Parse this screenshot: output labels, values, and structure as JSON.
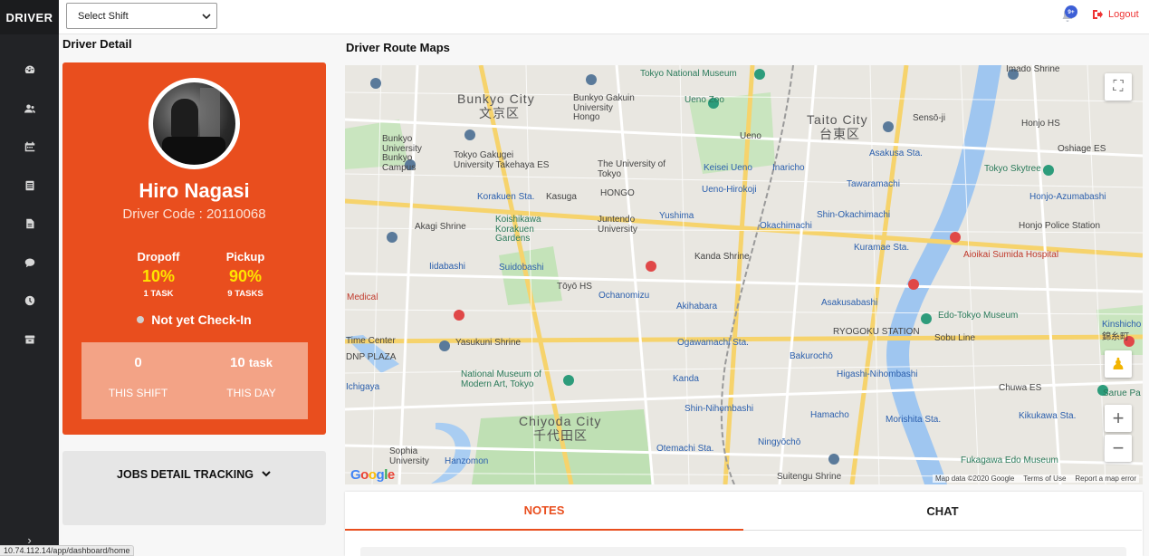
{
  "app": {
    "brand": "DRIVER"
  },
  "sidebar": {
    "items": [
      {
        "icon": "dashboard-icon"
      },
      {
        "icon": "users-icon"
      },
      {
        "icon": "calendar-icon"
      },
      {
        "icon": "list-icon"
      },
      {
        "icon": "file-icon"
      },
      {
        "icon": "chat-icon"
      },
      {
        "icon": "clock-icon"
      },
      {
        "icon": "archive-icon"
      }
    ],
    "expand_glyph": "›"
  },
  "topbar": {
    "shift_select": {
      "value": "Select Shift"
    },
    "notifications": {
      "badge": "9+"
    },
    "logout_label": "Logout"
  },
  "driver_detail": {
    "title": "Driver Detail",
    "name": "Hiro Nagasi",
    "code": "Driver Code : 20110068",
    "dropoff": {
      "label": "Dropoff",
      "value": "10%",
      "tasks": "1 TASK"
    },
    "pickup": {
      "label": "Pickup",
      "value": "90%",
      "tasks": "9 TASKS"
    },
    "checkin_status": "Not yet Check-In",
    "this_shift": {
      "count": "0",
      "label": "THIS SHIFT"
    },
    "this_day": {
      "count": "10",
      "unit": "task",
      "label": "THIS DAY"
    },
    "jobs_tracking": "JOBS DETAIL TRACKING"
  },
  "map": {
    "title": "Driver Route Maps",
    "labels": {
      "bunkyo": "Bunkyo City",
      "bunkyo_jp": "文京区",
      "taito": "Taito City",
      "taito_jp": "台東区",
      "chiyoda": "Chiyoda City",
      "chiyoda_jp": "千代田区",
      "tokyo_museum": "Tokyo National Museum",
      "ueno_zoo": "Ueno Zoo",
      "ueno": "Ueno",
      "senso": "Sensō-ji",
      "imado": "Imado Shrine",
      "asakusa": "Asakusa Sta.",
      "skytree": "Tokyo Skytree",
      "kasuga": "Kasuga",
      "koishikawa": "Koishikawa Korakuen Gardens",
      "juntendo": "Juntendo University",
      "kanda_shrine": "Kanda Shrine",
      "akihabara": "Akihabara",
      "ochanomizu": "Ochanomizu",
      "iidabashi": "Iidabashi",
      "suidobashi": "Suidobashi",
      "yasukuni": "Yasukuni Shrine",
      "national_museum": "National Museum of Modern Art, Tokyo",
      "aioikai": "Aioikai Sumida Hospital",
      "edo_museum": "Edo-Tokyo Museum",
      "ryogoku": "RYOGOKU STATION",
      "sobu": "Sobu Line",
      "kinshicho": "Kinshicho",
      "shin_nihombashi": "Shin-Nihombashi",
      "kanda": "Kanda",
      "ogawamachi": "Ogawamachi Sta.",
      "bakurocho": "Bakurochō",
      "higashi": "Higashi-Nihombashi",
      "hamacho": "Hamacho",
      "morishita": "Morishita Sta.",
      "kikukawa": "Kikukawa Sta.",
      "chuwa": "Chuwa ES",
      "ningyocho": "Ningyōchō",
      "otemachi": "Otemachi Sta.",
      "suitengu": "Suitengu Shrine",
      "sophia": "Sophia University",
      "hanzomon": "Hanzomon",
      "fukagawa": "Fukagawa Edo Museum",
      "honjo": "Honjo Police Station",
      "honjo_azumabashi": "Honjo-Azumabashi",
      "tawaramachi": "Tawaramachi",
      "asakusabashi": "Asakusabashi",
      "shin_okachimachi": "Shin-Okachimachi",
      "okachimachi": "Okachimachi",
      "inaricho": "Inaricho",
      "yushima": "Yushima",
      "hongo": "HONGO",
      "the_univ": "The University of Tokyo",
      "keisei_ueno": "Keisei Ueno",
      "ueno_hirokoji": "Ueno-Hirokoji",
      "kuramae": "Kuramae Sta.",
      "korakuen": "Korakuen Sta.",
      "akagi": "Akagi Shrine",
      "toyo": "Tōyō HS",
      "tokyo_gakugei": "Tokyo Gakugei University Takehaya ES",
      "bunkyo_gakuin": "Bunkyo Gakuin University Hongo",
      "bunkyo_univ": "Bunkyo University Bunkyo Campus",
      "ichigaya": "Ichigaya",
      "medical": "Medical",
      "time_center": "Time Center",
      "dnp": "DNP PLAZA",
      "honjo_hs": "Honjo HS",
      "oshiage": "Oshiage ES",
      "sarue": "Sarue Pa",
      "kinshicho_jp": "錦糸町"
    },
    "attribution": {
      "data": "Map data ©2020 Google",
      "terms": "Terms of Use",
      "report": "Report a map error"
    },
    "google": "Google",
    "zoom_in": "+",
    "zoom_out": "−"
  },
  "tabs": [
    {
      "label": "NOTES",
      "active": true
    },
    {
      "label": "CHAT",
      "active": false
    }
  ],
  "statusbar": {
    "url": "10.74.112.14/app/dashboard/home"
  },
  "colors": {
    "accent": "#e94e1e",
    "yellow": "#ffe400",
    "sidebar": "#222326"
  }
}
